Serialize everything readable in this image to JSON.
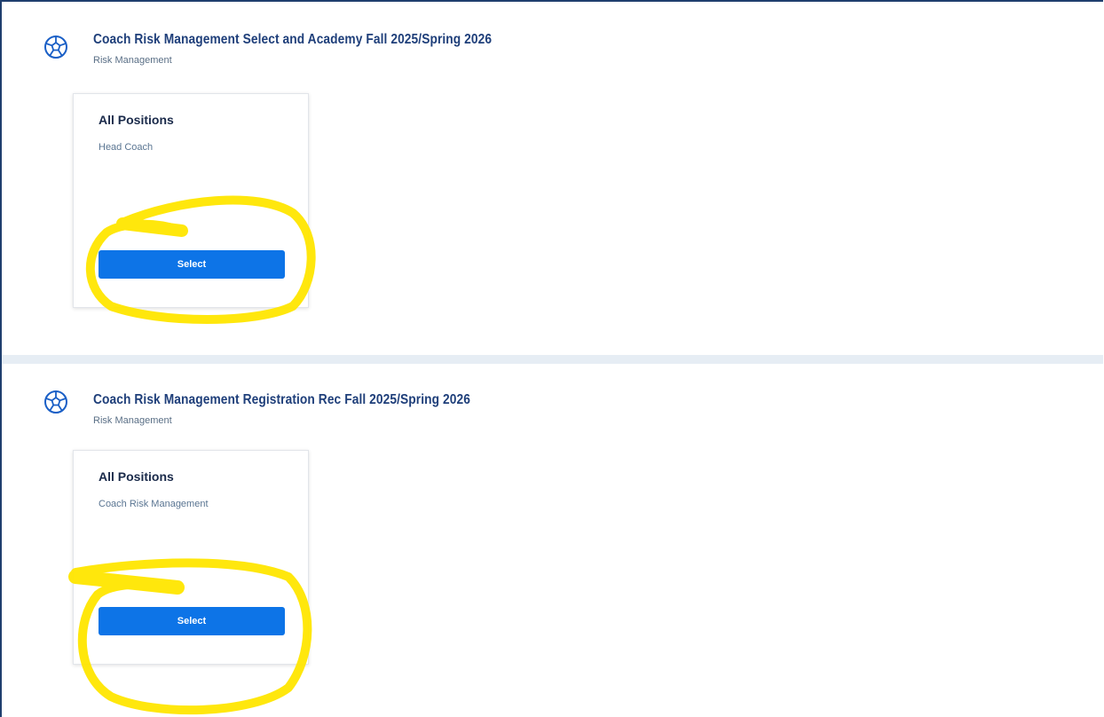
{
  "programs": [
    {
      "title": "Coach Risk Management Select and Academy Fall 2025/Spring 2026",
      "subtitle": "Risk Management",
      "card": {
        "title": "All Positions",
        "position": "Head Coach",
        "button_label": "Select"
      }
    },
    {
      "title": "Coach Risk Management Registration Rec Fall 2025/Spring 2026",
      "subtitle": "Risk Management",
      "card": {
        "title": "All Positions",
        "position": "Coach Risk Management",
        "button_label": "Select"
      }
    }
  ],
  "icons": {
    "program_icon": "soccer-ball-icon"
  },
  "colors": {
    "title": "#1f3f7a",
    "button": "#0d74e7",
    "highlight": "#ffe600",
    "divider": "#e6edf4"
  }
}
